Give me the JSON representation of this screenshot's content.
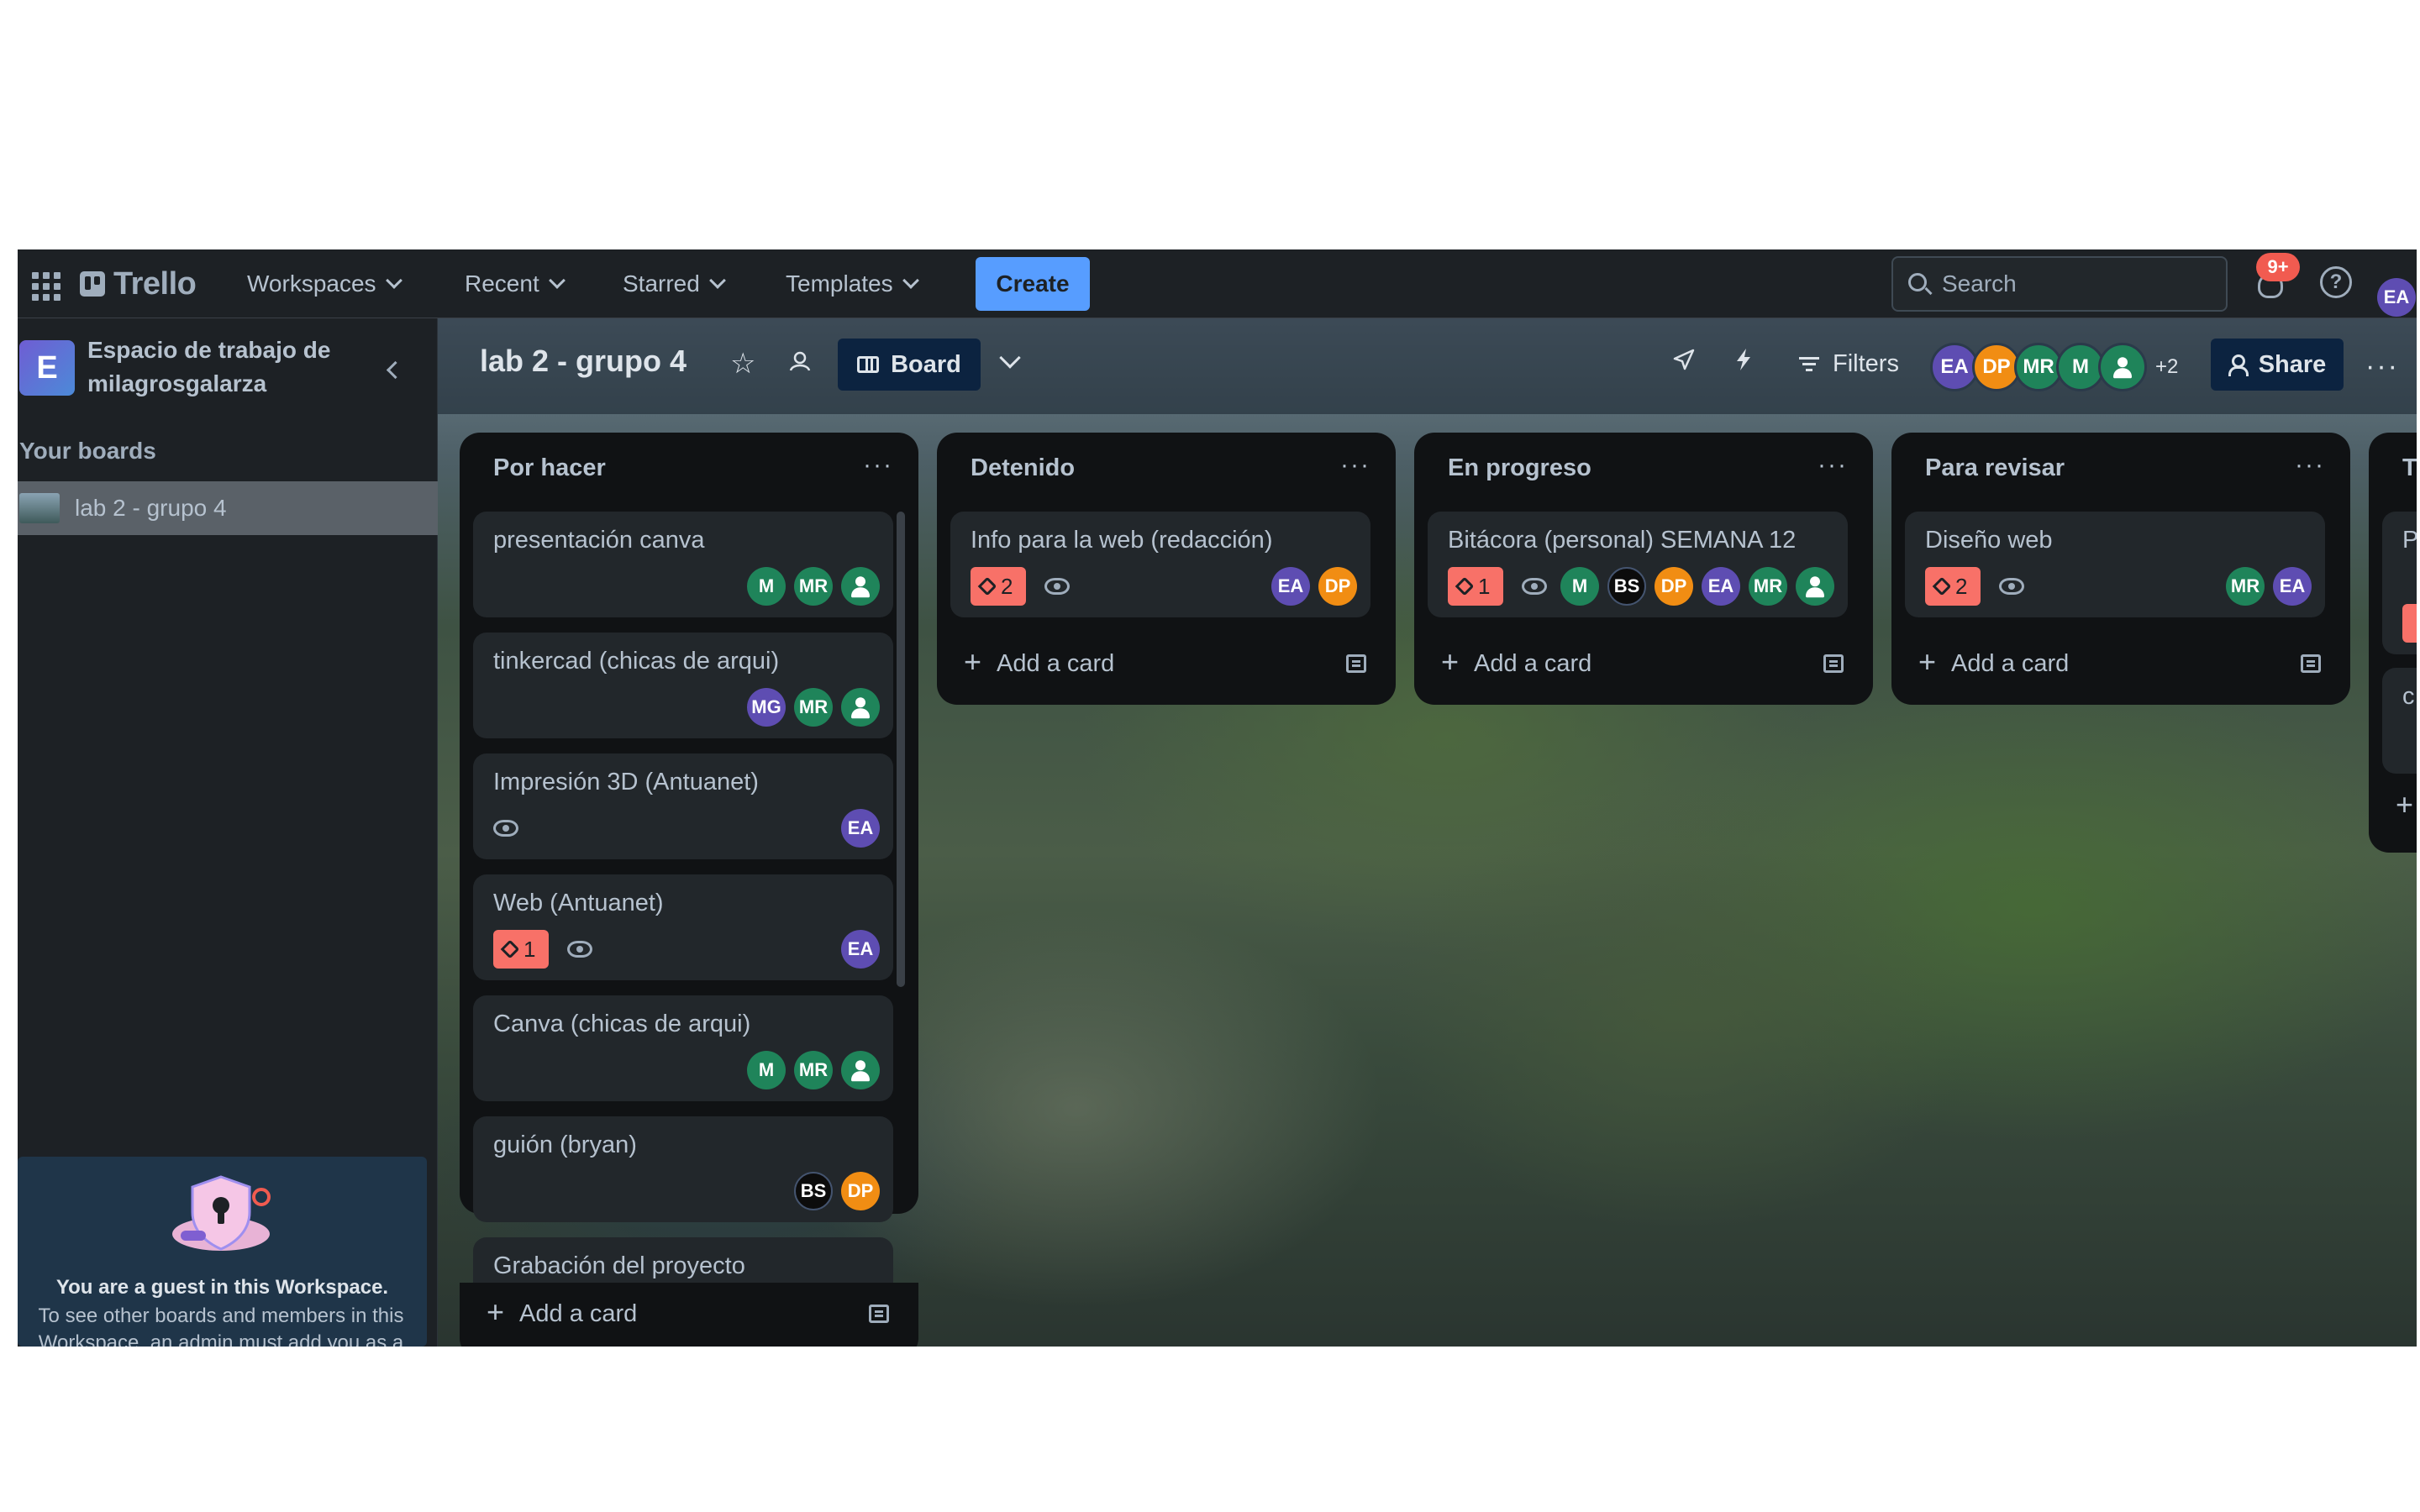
{
  "colors": {
    "nav_bg": "#1d2125",
    "list_bg": "#101214",
    "card_bg": "#22272b",
    "create_button": "#579dff",
    "label_red": "#f87168",
    "avatar_ea": "#5e4db2",
    "avatar_dp": "#f18d13",
    "avatar_green": "#1f845a",
    "avatar_bs": "#0c0c0c"
  },
  "topnav": {
    "apps_icon": "grid-icon",
    "logo_text": "Trello",
    "workspaces_label": "Workspaces",
    "recent_label": "Recent",
    "starred_label": "Starred",
    "templates_label": "Templates",
    "create_label": "Create",
    "search_placeholder": "Search",
    "notifications_badge": "9+",
    "help_label": "?",
    "user_initials": "EA"
  },
  "sidebar": {
    "workspace_letter": "E",
    "workspace_name": "Espacio de trabajo de milagrosgalarza",
    "your_boards_label": "Your boards",
    "boards": [
      {
        "label": "lab 2 - grupo 4"
      }
    ],
    "guest_title": "You are a guest in this Workspace.",
    "guest_body": "To see other boards and members in this Workspace, an admin must add you as a Workspace member."
  },
  "board": {
    "title": "lab 2 - grupo 4",
    "view_label": "Board",
    "filters_label": "Filters",
    "members": [
      {
        "initials": "EA",
        "color": "#5e4db2"
      },
      {
        "initials": "DP",
        "color": "#f18d13"
      },
      {
        "initials": "MR",
        "color": "#1f845a"
      },
      {
        "initials": "M",
        "color": "#1f845a"
      },
      {
        "initials": "",
        "color": "#1f845a",
        "icon": "person-icon"
      }
    ],
    "extra_members": "+2",
    "share_label": "Share"
  },
  "lists": [
    {
      "title": "Por hacer",
      "add_card_label": "Add a card",
      "cards": [
        {
          "title": "presentación canva",
          "labels": "",
          "watching": false,
          "members": [
            "M",
            "MR",
            "person"
          ]
        },
        {
          "title": "tinkercad (chicas de arqui)",
          "labels": "",
          "watching": false,
          "members": [
            "MG",
            "MR",
            "person"
          ]
        },
        {
          "title": "Impresión 3D (Antuanet)",
          "labels": "",
          "watching": true,
          "members": [
            "EA"
          ]
        },
        {
          "title": "Web (Antuanet)",
          "labels": "1",
          "watching": true,
          "members": [
            "EA"
          ]
        },
        {
          "title": "Canva (chicas de arqui)",
          "labels": "",
          "watching": false,
          "members": [
            "M",
            "MR",
            "person"
          ]
        },
        {
          "title": "guión (bryan)",
          "labels": "",
          "watching": false,
          "members": [
            "BS",
            "DP"
          ]
        },
        {
          "title": "Grabación del proyecto",
          "labels": "",
          "watching": false,
          "members": []
        }
      ]
    },
    {
      "title": "Detenido",
      "add_card_label": "Add a card",
      "cards": [
        {
          "title": "Info para la web (redacción)",
          "labels": "2",
          "watching": true,
          "members": [
            "EA",
            "DP"
          ]
        }
      ]
    },
    {
      "title": "En progreso",
      "add_card_label": "Add a card",
      "cards": [
        {
          "title": "Bitácora (personal) SEMANA 12",
          "labels": "1",
          "watching": true,
          "members": [
            "M",
            "BS",
            "DP",
            "EA",
            "MR",
            "person"
          ]
        }
      ]
    },
    {
      "title": "Para revisar",
      "add_card_label": "Add a card",
      "cards": [
        {
          "title": "Diseño web",
          "labels": "2",
          "watching": true,
          "members": [
            "MR",
            "EA"
          ]
        }
      ]
    },
    {
      "title": "T",
      "add_card_label": "+",
      "cards": [
        {
          "title": "P s",
          "labels": "",
          "watching": false,
          "members": []
        },
        {
          "title": "c",
          "labels": "",
          "watching": false,
          "members": []
        }
      ]
    }
  ]
}
